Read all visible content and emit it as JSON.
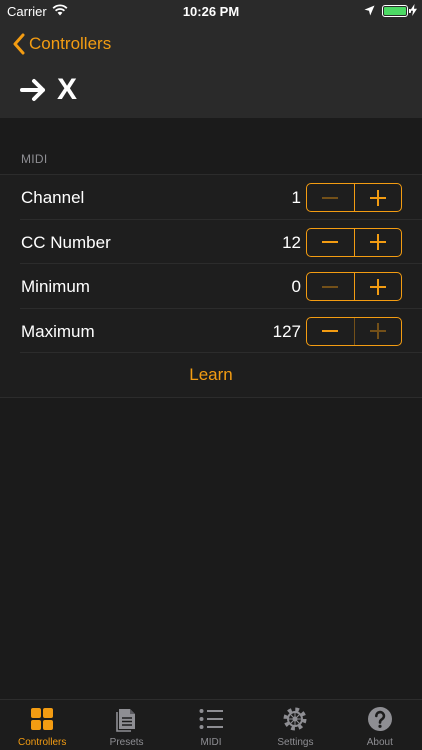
{
  "status_bar": {
    "carrier": "Carrier",
    "time": "10:26 PM",
    "battery_level": 1.0,
    "battery_color": "#4cd964"
  },
  "nav": {
    "back_label": "Controllers",
    "title": "X",
    "title_icon": "arrow-right-icon",
    "accent_color": "#f39c12"
  },
  "section": {
    "header": "MIDI",
    "rows": [
      {
        "label": "Channel",
        "value": "1",
        "minus_enabled": false,
        "plus_enabled": true
      },
      {
        "label": "CC Number",
        "value": "12",
        "minus_enabled": true,
        "plus_enabled": true
      },
      {
        "label": "Minimum",
        "value": "0",
        "minus_enabled": false,
        "plus_enabled": true
      },
      {
        "label": "Maximum",
        "value": "127",
        "minus_enabled": true,
        "plus_enabled": false
      }
    ],
    "learn_label": "Learn"
  },
  "tabbar": {
    "items": [
      {
        "label": "Controllers",
        "icon": "grid-icon",
        "active": true
      },
      {
        "label": "Presets",
        "icon": "document-icon",
        "active": false
      },
      {
        "label": "MIDI",
        "icon": "list-icon",
        "active": false
      },
      {
        "label": "Settings",
        "icon": "gear-icon",
        "active": false
      },
      {
        "label": "About",
        "icon": "question-icon",
        "active": false
      }
    ]
  }
}
